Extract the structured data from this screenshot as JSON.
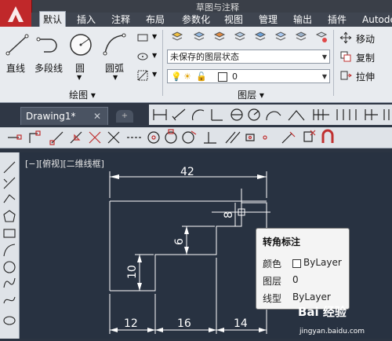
{
  "title_bar": {
    "doc_title": "草图与注释"
  },
  "ribbon_tabs": [
    "默认",
    "插入",
    "注释",
    "布局",
    "参数化",
    "视图",
    "管理",
    "输出",
    "插件",
    "Autodesk"
  ],
  "draw_panel": {
    "title": "绘图",
    "tools": [
      "直线",
      "多段线",
      "圆",
      "圆弧"
    ]
  },
  "layer_panel": {
    "title": "图层",
    "layer_state": "未保存的图层状态",
    "current_layer": "0"
  },
  "modify_panel": {
    "tools": [
      "移动",
      "复制",
      "拉伸"
    ]
  },
  "file_tab": {
    "name": "Drawing1*",
    "close": "✕"
  },
  "viewport_label": "[−][俯视][二维线框]",
  "dimensions": {
    "top": "42",
    "right_small": "8",
    "mid_vertical": "6",
    "left_vertical": "10",
    "bottom_left": "12",
    "bottom_mid": "16",
    "bottom_right": "14"
  },
  "tooltip": {
    "title": "转角标注",
    "rows": [
      {
        "label": "颜色",
        "value": "ByLayer"
      },
      {
        "label": "图层",
        "value": "0"
      },
      {
        "label": "线型",
        "value": "ByLayer"
      }
    ]
  },
  "watermark": {
    "brand": "Bai 经验",
    "url": "jingyan.baidu.com"
  },
  "colors": {
    "app_red": "#c0282a",
    "canvas": "#283241",
    "ribbon": "#e8ebef"
  }
}
